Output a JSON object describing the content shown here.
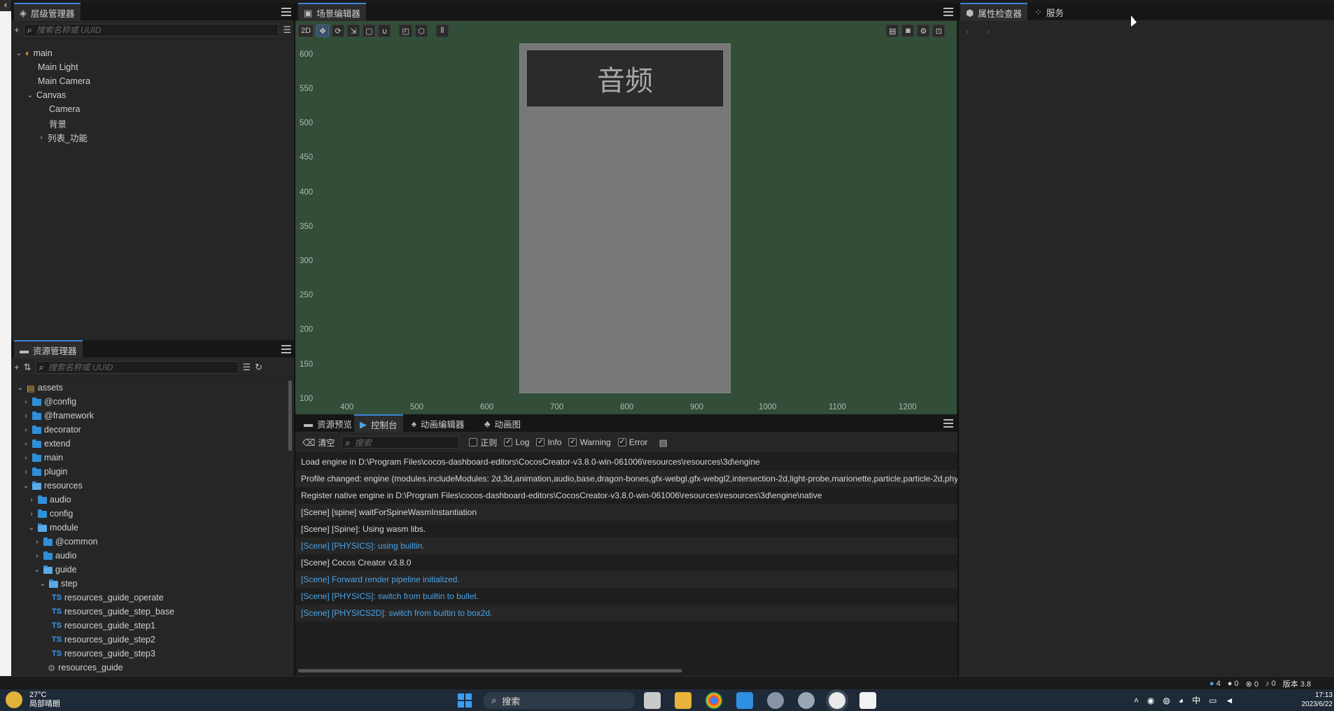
{
  "hierarchy": {
    "tab": "层级管理器",
    "search_placeholder": "搜索名称或 UUID",
    "nodes": [
      "main",
      "Main Light",
      "Main Camera",
      "Canvas",
      "Camera",
      "背景",
      "列表_功能"
    ]
  },
  "assets": {
    "tab": "资源管理器",
    "search_placeholder": "搜索名称或 UUID",
    "items": [
      "assets",
      "@config",
      "@framework",
      "decorator",
      "extend",
      "main",
      "plugin",
      "resources",
      "audio",
      "config",
      "module",
      "@common",
      "audio",
      "guide",
      "step",
      "resources_guide_operate",
      "resources_guide_step_base",
      "resources_guide_step1",
      "resources_guide_step2",
      "resources_guide_step3",
      "resources_guide"
    ],
    "ts_label": "TS"
  },
  "scene": {
    "tab": "场景编辑器",
    "mode_2d": "2D",
    "y_ticks": [
      "600",
      "550",
      "500",
      "450",
      "400",
      "350",
      "300",
      "250",
      "200",
      "150",
      "100"
    ],
    "x_ticks": [
      "400",
      "500",
      "600",
      "700",
      "800",
      "900",
      "1000",
      "1100",
      "1200"
    ],
    "title_text": "音频"
  },
  "bottom_tabs": [
    "资源预览",
    "控制台",
    "动画编辑器",
    "动画图"
  ],
  "console": {
    "clear": "清空",
    "search_placeholder": "搜索",
    "regex": "正则",
    "filters": [
      "Log",
      "Info",
      "Warning",
      "Error"
    ],
    "lines": [
      "Load engine in D:\\Program Files\\cocos-dashboard-editors\\CocosCreator-v3.8.0-win-061006\\resources\\resources\\3d\\engine",
      "Profile changed: engine (modules.includeModules: 2d,3d,animation,audio,base,dragon-bones,gfx-webgl,gfx-webgl2,intersection-2d,light-probe,marionette,particle,particle-2d,phy",
      "Register native engine in D:\\Program Files\\cocos-dashboard-editors\\CocosCreator-v3.8.0-win-061006\\resources\\resources\\3d\\engine\\native",
      "[Scene] [spine] waitForSpineWasmInstantiation",
      "[Scene] [Spine]: Using wasm libs.",
      "[Scene] [PHYSICS]: using builtin.",
      "[Scene] Cocos Creator v3.8.0",
      "[Scene] Forward render pipeline initialized.",
      "[Scene] [PHYSICS]: switch from builtin to bullet.",
      "[Scene] [PHYSICS2D]: switch from builtin to box2d."
    ]
  },
  "inspector": {
    "tab": "属性检查器",
    "service_tab": "服务"
  },
  "status": {
    "info": "4",
    "warn": "0",
    "error": "0",
    "notify": "0",
    "version": "版本 3.8"
  },
  "taskbar": {
    "temp": "27°C",
    "weather": "局部晴朗",
    "search": "搜索",
    "ime": "中",
    "time": "17:13",
    "date": "2023/6/22"
  },
  "colors": {
    "accent": "#3a86d6",
    "scene_bg": "#324d38",
    "info_text": "#4aa3e6"
  }
}
